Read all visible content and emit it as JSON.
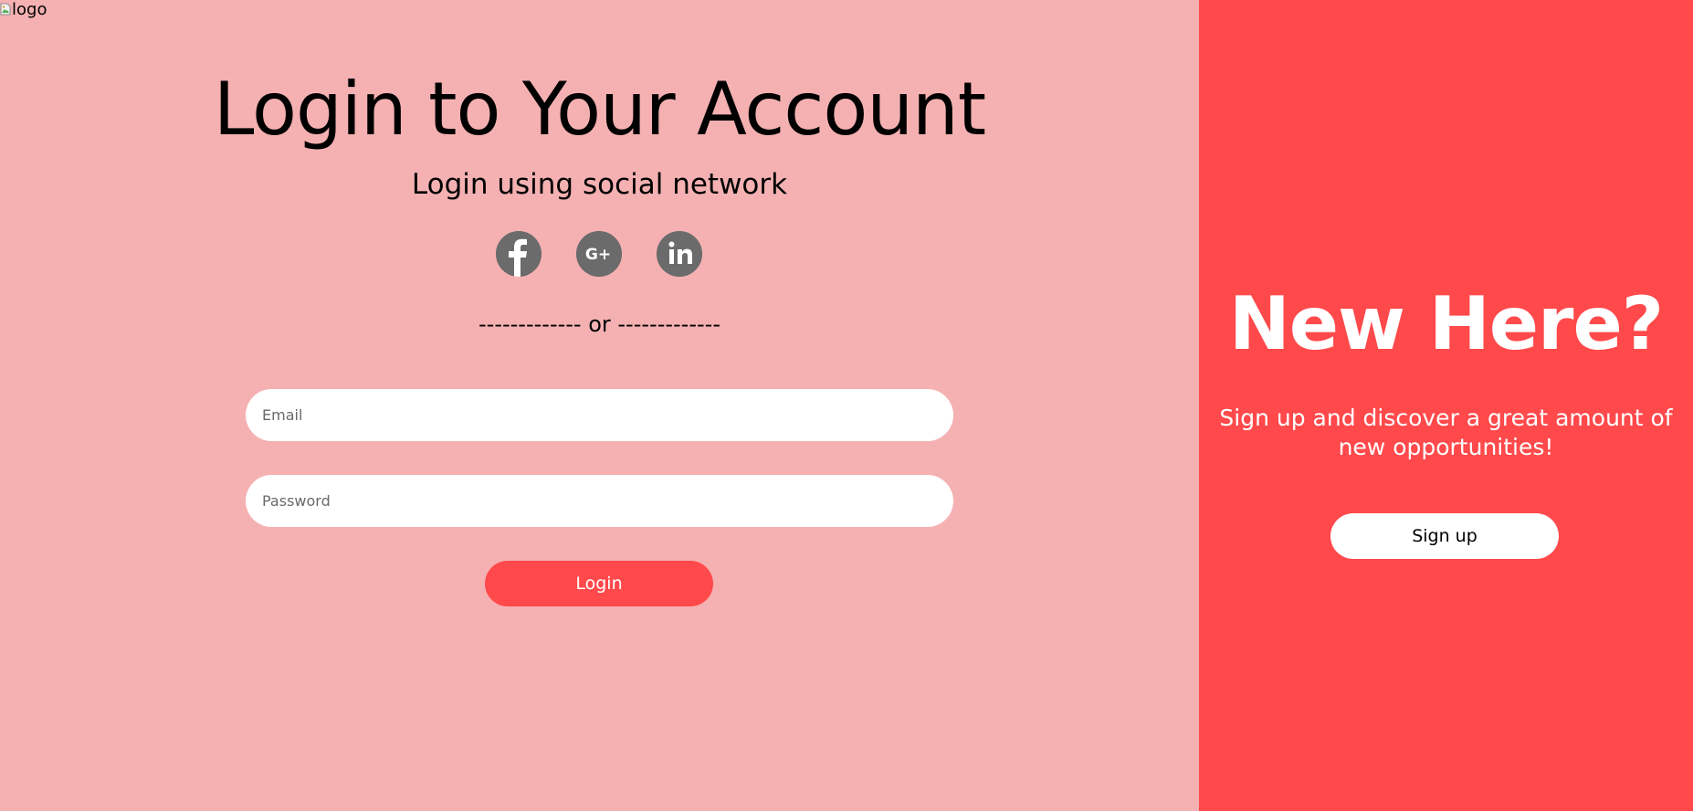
{
  "logo": {
    "alt_text": "logo"
  },
  "login": {
    "title": "Login to Your Account",
    "subtitle": "Login using social network",
    "social": [
      {
        "name": "facebook-icon",
        "color": "#6b6b6b"
      },
      {
        "name": "google-plus-icon",
        "color": "#6b6b6b"
      },
      {
        "name": "linkedin-icon",
        "color": "#6b6b6b"
      }
    ],
    "divider": "------------- or -------------",
    "email_placeholder": "Email",
    "password_placeholder": "Password",
    "login_label": "Login"
  },
  "signup": {
    "title": "New Here?",
    "text": "Sign up and discover a great amount of new opportunities!",
    "button_label": "Sign up"
  },
  "colors": {
    "left_bg": "#f5b1b2",
    "right_bg": "#ff494b",
    "accent": "#ff494b",
    "icon_gray": "#6b6b6b"
  }
}
